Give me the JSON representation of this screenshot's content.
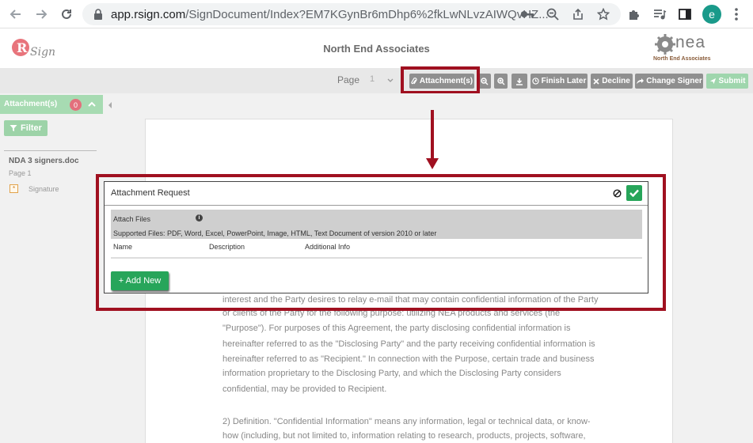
{
  "browser": {
    "url_host": "app.rsign.com",
    "url_path": "/SignDocument/Index?EM7KGynBr6mDhp6%2fkLwNLvzAIWQvHZ...",
    "profile_initial": "e"
  },
  "header": {
    "logo_text": "RSign",
    "company_title": "North End Associates",
    "company_logo_text": "nea",
    "company_logo_sub": "North End Associates"
  },
  "toolbar": {
    "page_label": "Page",
    "page_value": "1",
    "attachments_label": "Attachment(s)",
    "finish_later_label": "Finish Later",
    "decline_label": "Decline",
    "change_signer_label": "Change Signer",
    "submit_label": "Submit"
  },
  "sidebar": {
    "section_label": "Attachment(s)",
    "badge_count": "0",
    "filter_label": "Filter",
    "document_name": "NDA 3 signers.doc",
    "page_label": "Page 1",
    "signature_label": "Signature"
  },
  "modal": {
    "title": "Attachment Request",
    "attach_files_label": "Attach Files",
    "supported_files": "Supported Files: PDF, Word, Excel, PowerPoint, Image, HTML, Text Document of version 2010 or later",
    "columns": [
      "Name",
      "Description",
      "Additional Info"
    ],
    "add_new_label": "+ Add New"
  },
  "document": {
    "lines": [
      "interest and the Party desires to relay e-mail that may contain confidential information of the Party",
      "or clients of the Party for the following purpose: utilizing NEA products and services (the",
      "\"Purpose\").  For purposes of this Agreement, the party disclosing confidential information is",
      "hereinafter referred to as the \"Disclosing Party\" and the party receiving confidential information is",
      "hereinafter referred to as \"Recipient.\"  In connection with the Purpose, certain trade and business",
      "information proprietary to the Disclosing Party, and which the Disclosing Party considers",
      "confidential, may be provided to Recipient.",
      "2) Definition.  \"Confidential Information\" means any information, legal or technical data, or know-",
      "how (including, but not limited to, information relating to research, products, projects, software,"
    ]
  },
  "colors": {
    "accent_green": "#27a55a",
    "light_green": "#a7dbb2",
    "callout_red": "#a01020",
    "toolbar_gray": "#8f8f8f"
  }
}
